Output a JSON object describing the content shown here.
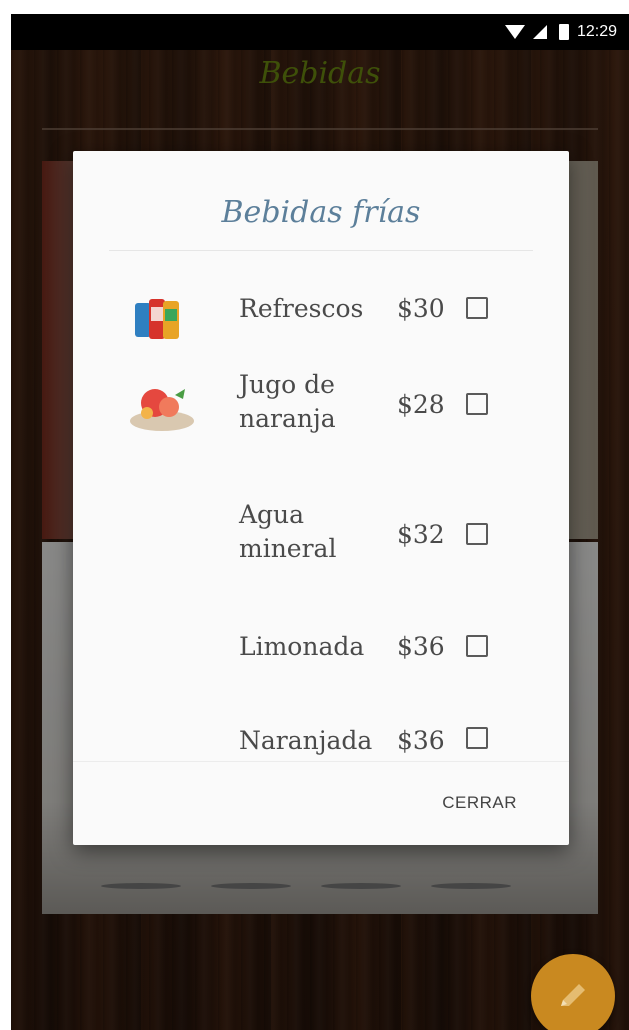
{
  "status_bar": {
    "time": "12:29"
  },
  "app": {
    "title": "Bebidas"
  },
  "dialog": {
    "title": "Bebidas frías",
    "items": [
      {
        "name_line1": "Refrescos",
        "name_line2": "",
        "price": "$30",
        "checked": false,
        "icon": "soda-cans-icon"
      },
      {
        "name_line1": "Jugo de",
        "name_line2": "naranja",
        "price": "$28",
        "checked": false,
        "icon": "juice-fruit-icon"
      },
      {
        "name_line1": "Agua",
        "name_line2": "mineral",
        "price": "$32",
        "checked": false
      },
      {
        "name_line1": "Limonada",
        "name_line2": "",
        "price": "$36",
        "checked": false
      },
      {
        "name_line1": "Naranjada",
        "name_line2": "",
        "price": "$36",
        "checked": false
      }
    ],
    "close_label": "CERRAR"
  },
  "fab": {
    "icon": "pencil-icon",
    "color": "#c98920"
  },
  "colors": {
    "app_title": "#6c8a10",
    "dialog_title": "#5c7f9a"
  }
}
